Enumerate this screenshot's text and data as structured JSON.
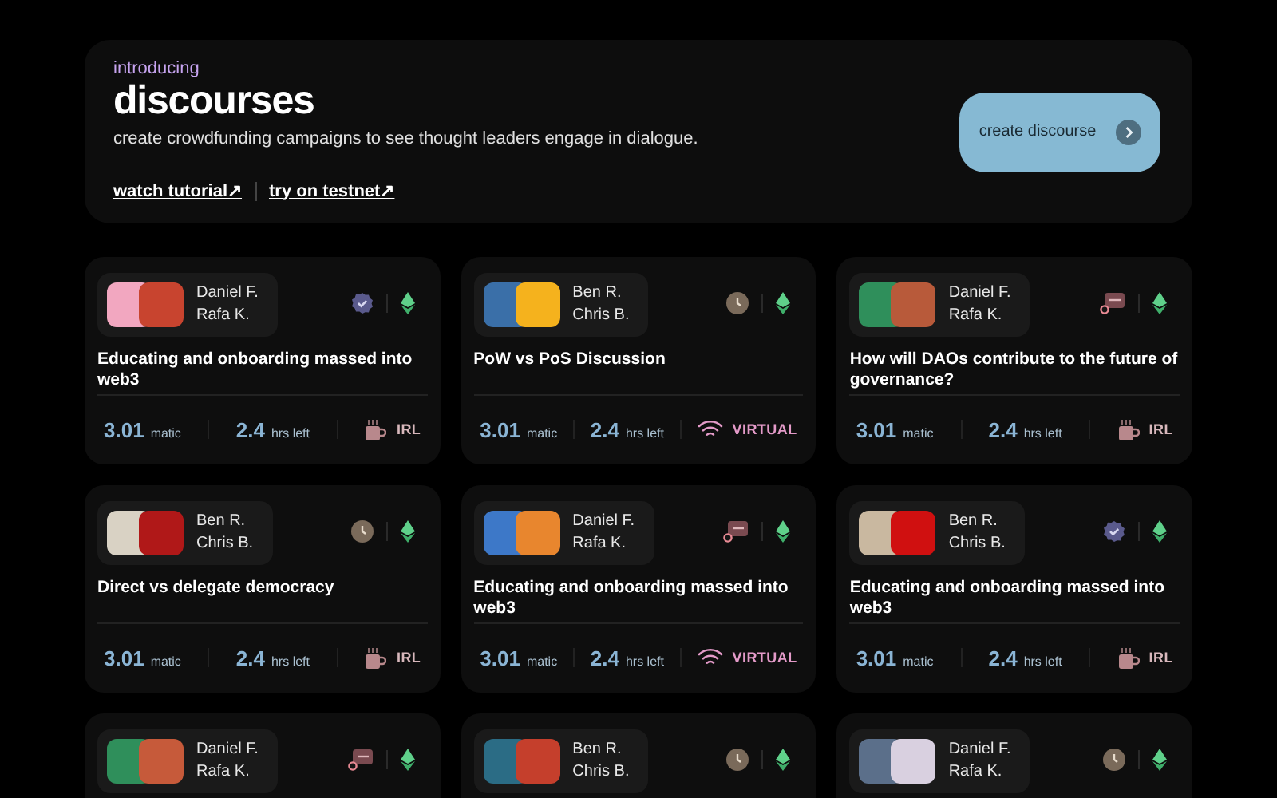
{
  "hero": {
    "eyebrow": "introducing",
    "title": "discourses",
    "subtitle": "create crowdfunding campaigns to see thought leaders engage in dialogue.",
    "links": [
      "watch tutorial↗",
      "try on testnet↗"
    ],
    "button": "create discourse"
  },
  "cards": [
    {
      "speakers": [
        "Daniel F.",
        "Rafa K."
      ],
      "status": {
        "kind": "verified"
      },
      "title": "Educating and onboarding massed into web3",
      "amount": "3.01",
      "unit": "matic",
      "time": "2.4",
      "time_unit": "hrs left",
      "format": {
        "kind": "irl",
        "label": "IRL"
      }
    },
    {
      "speakers": [
        "Ben R.",
        "Chris B."
      ],
      "status": {
        "kind": "clock"
      },
      "title": "PoW vs PoS Discussion",
      "amount": "3.01",
      "unit": "matic",
      "time": "2.4",
      "time_unit": "hrs left",
      "format": {
        "kind": "virtual",
        "label": "VIRTUAL"
      }
    },
    {
      "speakers": [
        "Daniel F.",
        "Rafa K."
      ],
      "status": {
        "kind": "chat"
      },
      "title": "How will DAOs contribute to the future of governance?",
      "amount": "3.01",
      "unit": "matic",
      "time": "2.4",
      "time_unit": "hrs left",
      "format": {
        "kind": "irl",
        "label": "IRL"
      }
    },
    {
      "speakers": [
        "Ben R.",
        "Chris B."
      ],
      "status": {
        "kind": "clock"
      },
      "title": "Direct vs delegate democracy",
      "amount": "3.01",
      "unit": "matic",
      "time": "2.4",
      "time_unit": "hrs left",
      "format": {
        "kind": "irl",
        "label": "IRL"
      }
    },
    {
      "speakers": [
        "Daniel F.",
        "Rafa K."
      ],
      "status": {
        "kind": "chat"
      },
      "title": "Educating and onboarding massed into web3",
      "amount": "3.01",
      "unit": "matic",
      "time": "2.4",
      "time_unit": "hrs left",
      "format": {
        "kind": "virtual",
        "label": "VIRTUAL"
      }
    },
    {
      "speakers": [
        "Ben R.",
        "Chris B."
      ],
      "status": {
        "kind": "verified"
      },
      "title": "Educating and onboarding massed into web3",
      "amount": "3.01",
      "unit": "matic",
      "time": "2.4",
      "time_unit": "hrs left",
      "format": {
        "kind": "irl",
        "label": "IRL"
      }
    },
    {
      "speakers": [
        "Daniel F.",
        "Rafa K."
      ],
      "status": {
        "kind": "chat"
      }
    },
    {
      "speakers": [
        "Ben R.",
        "Chris B."
      ],
      "status": {
        "kind": "clock"
      }
    },
    {
      "speakers": [
        "Daniel F.",
        "Rafa K."
      ],
      "status": {
        "kind": "clock"
      }
    }
  ]
}
